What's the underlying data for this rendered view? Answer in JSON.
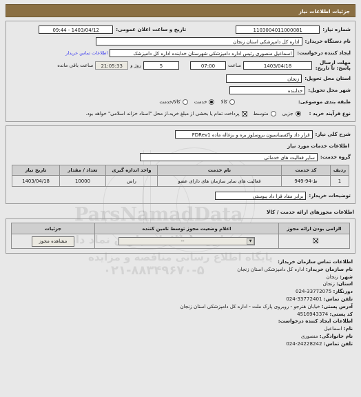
{
  "header": {
    "title": "جزئیات اطلاعات نیاز"
  },
  "form": {
    "req_no_label": "شماره نیاز:",
    "req_no_value": "1103004011000081",
    "announce_label": "تاریخ و ساعت اعلان عمومی:",
    "announce_value": "1403/04/12 - 09:44",
    "buyer_org_label": "نام دستگاه خریدار:",
    "buyer_org_value": "اداره کل دامپزشکی استان زنجان",
    "creator_label": "ایجاد کننده درخواست:",
    "creator_value": "اسماعیل منصوری رئیس اداره دامپزشکی شهرستان خدابنده اداره کل دامپزشک",
    "contact_link": "اطلاعات تماس خریدار",
    "deadline_label": "مهلت ارسال پاسخ: تا تاریخ:",
    "deadline_date": "1403/04/18",
    "hour_label": "ساعت",
    "hour_value": "07:00",
    "day_value": "5",
    "day_label": "روز و",
    "countdown_value": "21:05:33",
    "countdown_label": "ساعت باقی مانده",
    "province_label": "استان محل تحویل:",
    "province_value": "زنجان",
    "city_label": "شهر محل تحویل:",
    "city_value": "خدابنده",
    "category_label": "طبقه بندی موضوعی:",
    "category_options": [
      {
        "label": "کالا",
        "selected": false
      },
      {
        "label": "خدمت",
        "selected": true
      },
      {
        "label": "کالا/خدمت",
        "selected": false
      }
    ],
    "process_label": "نوع فرآیند خرید :",
    "process_options": [
      {
        "label": "جزیی",
        "selected": true
      },
      {
        "label": "متوسط",
        "selected": false
      }
    ],
    "treasury_checkbox_checked": true,
    "treasury_note": "پرداخت تمام یا بخشی از مبلغ خرید،از محل \"اسناد خزانه اسلامی\" خواهد بود."
  },
  "summary": {
    "label": "شرح کلی نیاز:",
    "value": "قرار داد واکسیناسیون بروسلوز بره و بزغاله ماده FDRev1"
  },
  "services": {
    "section_title": "اطلاعات خدمات مورد نیاز",
    "group_label": "گروه خدمت:",
    "group_value": "سایر فعالیت های خدماتی",
    "columns": [
      "ردیف",
      "کد خدمت",
      "نام خدمت",
      "واحد اندازه گیری",
      "تعداد / مقدار",
      "تاریخ نیاز"
    ],
    "rows": [
      {
        "index": "1",
        "code": "ط-94-949",
        "name": "فعالیت های سایر سازمان های دارای عضو",
        "unit": "راس",
        "qty": "10000",
        "date": "1403/04/18"
      }
    ],
    "notes_label": "توضیحات خریدار:",
    "notes_value": "برابر مفاد قرا داد پیوستی"
  },
  "permits": {
    "section_title": "اطلاعات مجوزهای ارائه خدمت / کالا",
    "columns": [
      "الزامی بودن ارائه مجوز",
      "اعلام وضعیت مجوز توسط تامین کننده",
      "جزئیات"
    ],
    "rows": [
      {
        "required_checked": true,
        "status_value": "--",
        "detail_button": "مشاهده مجوز"
      }
    ]
  },
  "contact": {
    "title": "اطلاعات تماس سازمان خریدار:",
    "org_key": "نام سازمان خریدار:",
    "org_value": "اداره کل دامپزشکی استان زنجان",
    "city_key": "شهر:",
    "city_value": "زنجان",
    "province_key": "استان:",
    "province_value": "زنجان",
    "fax_key": "دورنگار:",
    "fax_value": "33772075-024",
    "phone_key": "تلفن تماس:",
    "phone_value": "33772401-024",
    "address_key": "آدرس پستی:",
    "address_value": "خیابان هنرجو - روبروی پارک ملت - اداره کل دامپزشکی استان زنجان",
    "postal_key": "کد پستی:",
    "postal_value": "4516943374",
    "creator_title": "اطلاعات ایجاد کننده درخواست:",
    "first_name_key": "نام:",
    "first_name_value": "اسماعیل",
    "last_name_key": "نام خانوادگی:",
    "last_name_value": "منصوری",
    "creator_phone_key": "تلفن تماس:",
    "creator_phone_value": "24228242-024"
  },
  "watermark": {
    "line1": "ParsNamadData",
    "line2": "اوری اطلاعات پارس نماد داده",
    "line3": "پایگاه اطلاع رسانی مناقصه و مزایده",
    "line4": "۰۲۱-۸۸۳۴۹۶۷۰-۵"
  },
  "colors": {
    "title_bar": "#8a6f43",
    "link": "#3a3af0",
    "table_header": "#cfcfcf"
  }
}
